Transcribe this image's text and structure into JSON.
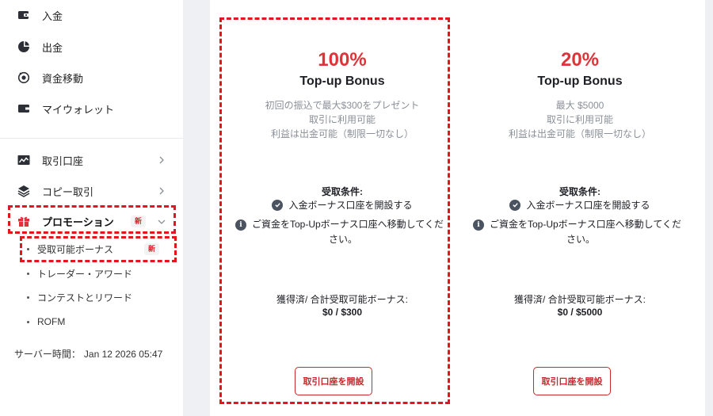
{
  "sidebar": {
    "items": [
      {
        "label": "入金",
        "icon": "deposit-icon"
      },
      {
        "label": "出金",
        "icon": "withdraw-icon"
      },
      {
        "label": "資金移動",
        "icon": "transfer-icon"
      },
      {
        "label": "マイウォレット",
        "icon": "wallet-icon"
      },
      {
        "label": "取引口座",
        "icon": "trading-account-icon"
      },
      {
        "label": "コピー取引",
        "icon": "copy-trade-icon"
      },
      {
        "label": "プロモーション",
        "icon": "gift-icon",
        "badge": "新"
      }
    ],
    "sub_items": [
      {
        "label": "受取可能ボーナス",
        "badge": "新"
      },
      {
        "label": "トレーダー・アワード"
      },
      {
        "label": "コンテストとリワード"
      },
      {
        "label": "ROFM"
      }
    ],
    "server_time_label": "サーバー時間：",
    "server_time_value": "Jan 12 2026 05:47"
  },
  "cards": [
    {
      "percent": "100%",
      "title": "Top-up Bonus",
      "desc": [
        "初回の振込で最大$300をプレゼント",
        "取引に利用可能",
        "利益は出金可能（制限一切なし）"
      ],
      "conditions_title": "受取条件:",
      "req1": "入金ボーナス口座を開設する",
      "req2_line1": "ご資金をTop-Upボーナス口座へ移動してくだ",
      "req2_line2": "さい。",
      "earned_label": "獲得済/ 合計受取可能ボーナス:",
      "earned_value": "$0 / $300",
      "button": "取引口座を開設"
    },
    {
      "percent": "20%",
      "title": "Top-up Bonus",
      "desc": [
        "最大 $5000",
        "取引に利用可能",
        "利益は出金可能（制限一切なし）"
      ],
      "conditions_title": "受取条件:",
      "req1": "入金ボーナス口座を開設する",
      "req2_line1": "ご資金をTop-Upボーナス口座へ移動してくだ",
      "req2_line2": "さい。",
      "earned_label": "獲得済/ 合計受取可能ボーナス:",
      "earned_value": "$0 / $5000",
      "button": "取引口座を開設"
    }
  ],
  "colors": {
    "accent": "#e0323a",
    "highlight_dash": "#e3151d",
    "button_border": "#c9282e",
    "background": "#eef0f3"
  }
}
